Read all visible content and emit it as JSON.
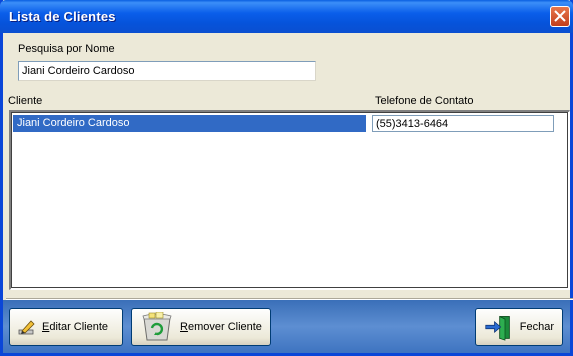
{
  "window": {
    "title": "Lista de Clientes"
  },
  "search": {
    "label": "Pesquisa por Nome",
    "value": "Jiani Cordeiro Cardoso"
  },
  "list": {
    "columns": [
      "Cliente",
      "Telefone de Contato"
    ],
    "rows": [
      {
        "cliente": "Jiani Cordeiro Cardoso",
        "telefone": "(55)3413-6464"
      }
    ]
  },
  "buttons": {
    "edit": {
      "accel": "E",
      "rest": "ditar Cliente",
      "icon": "pencil-edit-icon"
    },
    "remove": {
      "accel": "R",
      "rest": "emover Cliente",
      "icon": "recycle-bin-icon"
    },
    "close": {
      "label": "Fechar",
      "icon": "exit-door-icon"
    }
  },
  "colors": {
    "titlebar": "#0A5EEA",
    "selection": "#316AC5",
    "buttonbar": "#4A7FC8"
  }
}
